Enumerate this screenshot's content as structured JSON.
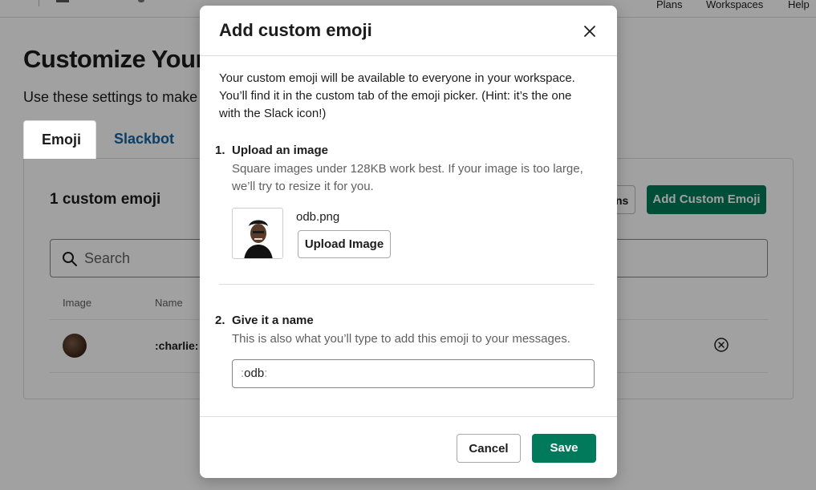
{
  "nav": {
    "links": [
      "Plans",
      "Workspaces",
      "Help"
    ]
  },
  "page": {
    "title": "Customize Your W",
    "subtitle": "Use these settings to make S",
    "tabs": [
      {
        "label": "Emoji",
        "active": true
      },
      {
        "label": "Slackbot",
        "active": false
      }
    ],
    "panel": {
      "heading": "1 custom emoji",
      "partial_button_label": "ns",
      "add_button_label": "Add Custom Emoji",
      "search_placeholder": "Search",
      "columns": [
        "Image",
        "Name"
      ],
      "rows": [
        {
          "name": ":charlie:"
        }
      ]
    }
  },
  "modal": {
    "title": "Add custom emoji",
    "intro": "Your custom emoji will be available to everyone in your workspace. You’ll find it in the custom tab of the emoji picker. (Hint: it’s the one with the Slack icon!)",
    "step1": {
      "number": "1.",
      "title": "Upload an image",
      "description": "Square images under 128KB work best. If your image is too large, we’ll try to resize it for you.",
      "file_name": "odb.png",
      "upload_label": "Upload Image"
    },
    "step2": {
      "number": "2.",
      "title": "Give it a name",
      "description": "This is also what you’ll type to add this emoji to your messages.",
      "name_prefix": ":",
      "name_value": "odb",
      "name_suffix": ":"
    },
    "cancel_label": "Cancel",
    "save_label": "Save"
  },
  "colors": {
    "primary_green": "#007a5a",
    "link_blue": "#1264a3",
    "text": "#1d1c1d",
    "muted_text": "#616061"
  },
  "icons": [
    "search-icon",
    "close-icon",
    "remove-circle-icon"
  ]
}
